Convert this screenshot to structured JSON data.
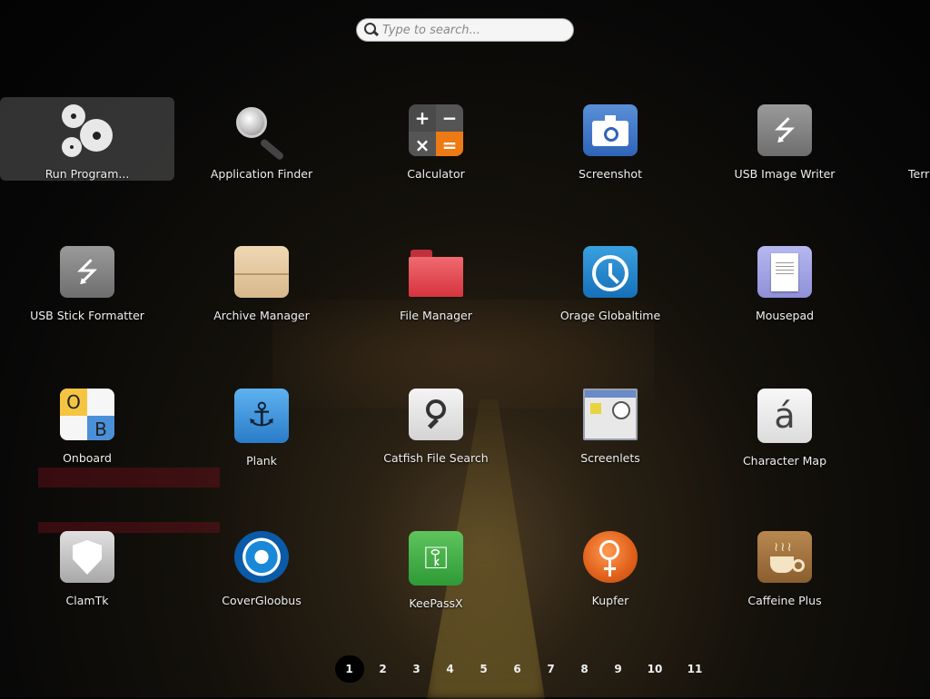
{
  "search": {
    "placeholder": "Type to search..."
  },
  "apps": [
    {
      "label": "Run Program...",
      "icon": "gears-icon",
      "selected": true
    },
    {
      "label": "Application Finder",
      "icon": "magnifier-icon"
    },
    {
      "label": "Calculator",
      "icon": "calculator-icon"
    },
    {
      "label": "Screenshot",
      "icon": "camera-icon"
    },
    {
      "label": "USB Image Writer",
      "icon": "usb-icon"
    },
    {
      "label": "Terr",
      "icon": "terminal-icon"
    },
    {
      "label": "USB Stick Formatter",
      "icon": "usb-icon"
    },
    {
      "label": "Archive Manager",
      "icon": "archive-icon"
    },
    {
      "label": "File Manager",
      "icon": "folder-icon"
    },
    {
      "label": "Orage Globaltime",
      "icon": "clock-icon"
    },
    {
      "label": "Mousepad",
      "icon": "notepad-icon"
    },
    {
      "label": "Onboard",
      "icon": "keyboard-icon"
    },
    {
      "label": "Plank",
      "icon": "anchor-icon"
    },
    {
      "label": "Catfish File Search",
      "icon": "search-icon"
    },
    {
      "label": "Screenlets",
      "icon": "screenlets-icon"
    },
    {
      "label": "Character Map",
      "icon": "character-icon"
    },
    {
      "label": "ClamTk",
      "icon": "shield-icon"
    },
    {
      "label": "CoverGloobus",
      "icon": "cover-icon"
    },
    {
      "label": "KeePassX",
      "icon": "key-icon"
    },
    {
      "label": "Kupfer",
      "icon": "kupfer-icon"
    },
    {
      "label": "Caffeine Plus",
      "icon": "coffee-icon"
    }
  ],
  "icon_glyphs": {
    "usb": "⭍",
    "onboard_o": "O",
    "onboard_b": "B",
    "plank": "⚓",
    "charmap": "á",
    "keepass": "⚿",
    "calc_plus": "+",
    "calc_minus": "−",
    "calc_times": "×",
    "calc_equals": "=",
    "caffeine_steam": "≀≀≀"
  },
  "pager": {
    "pages": [
      "1",
      "2",
      "3",
      "4",
      "5",
      "6",
      "7",
      "8",
      "9",
      "10",
      "11"
    ],
    "current": "1"
  }
}
